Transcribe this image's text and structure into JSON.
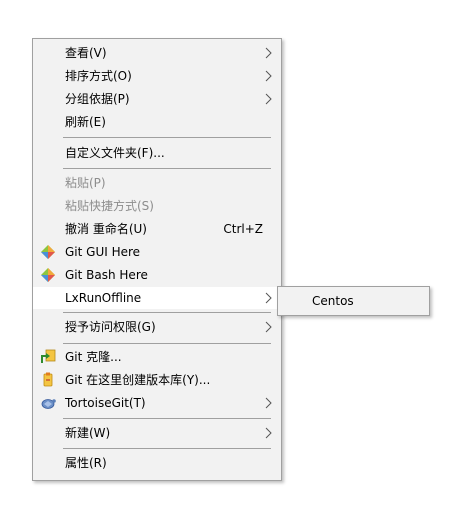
{
  "context_menu": {
    "view": "查看(V)",
    "sort_by": "排序方式(O)",
    "group_by": "分组依据(P)",
    "refresh": "刷新(E)",
    "customize_folder": "自定义文件夹(F)...",
    "paste": "粘贴(P)",
    "paste_shortcut": "粘贴快捷方式(S)",
    "undo_rename": "撤消 重命名(U)",
    "undo_shortcut": "Ctrl+Z",
    "git_gui": "Git GUI Here",
    "git_bash": "Git Bash Here",
    "lxrunoffline": "LxRunOffline",
    "grant_access": "授予访问权限(G)",
    "git_clone": "Git 克隆...",
    "git_create_repo": "Git 在这里创建版本库(Y)...",
    "tortoisegit": "TortoiseGit(T)",
    "new": "新建(W)",
    "properties": "属性(R)"
  },
  "submenu": {
    "centos": "Centos"
  },
  "icons": {
    "git_gui": "git-diamond-icon",
    "git_bash": "git-diamond-icon",
    "git_clone": "git-clone-icon",
    "git_create_repo": "git-create-repo-icon",
    "tortoisegit": "tortoisegit-icon",
    "submenu_arrow": "chevron-right-icon"
  },
  "colors": {
    "menu_bg": "#f2f2f2",
    "border": "#a0a0a0",
    "disabled_text": "#8d8d8d",
    "hover_bg": "#ffffff"
  }
}
